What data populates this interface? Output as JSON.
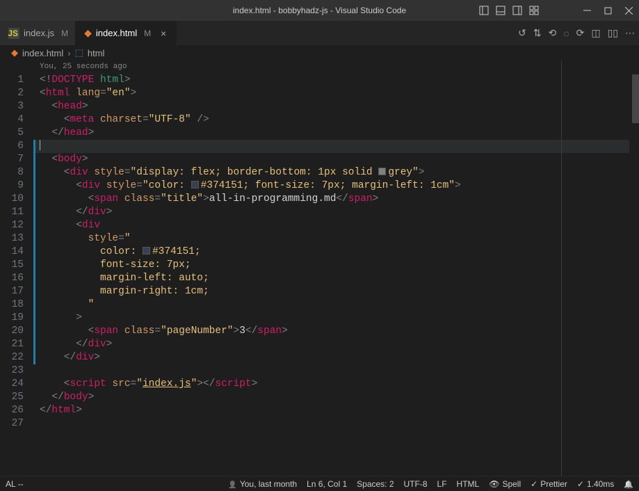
{
  "titleBar": {
    "title": "index.html - bobbyhadz-js - Visual Studio Code"
  },
  "tabs": {
    "items": [
      {
        "label": "index.js",
        "modified": "M"
      },
      {
        "label": "index.html",
        "modified": "M"
      }
    ]
  },
  "breadcrumb": {
    "file": "index.html",
    "symbol": "html"
  },
  "codelens": {
    "text": "You, 25 seconds ago"
  },
  "status": {
    "left": {
      "mode": "AL --"
    },
    "right": {
      "blame": "You, last month",
      "cursor": "Ln 6, Col 1",
      "spaces": "Spaces: 2",
      "encoding": "UTF-8",
      "eol": "LF",
      "lang": "HTML",
      "spell": "Spell",
      "prettier": "Prettier",
      "time": "1.40ms"
    }
  },
  "code": {
    "lines": [
      "1",
      "2",
      "3",
      "4",
      "5",
      "6",
      "7",
      "8",
      "9",
      "10",
      "11",
      "12",
      "13",
      "14",
      "15",
      "16",
      "17",
      "18",
      "19",
      "20",
      "21",
      "22",
      "23",
      "24",
      "25",
      "26",
      "27"
    ],
    "l1_a": "<!",
    "l1_b": "DOCTYPE",
    "l1_c": " html",
    "l1_d": ">",
    "l2_a": "<",
    "l2_b": "html",
    "l2_c": " lang",
    "l2_d": "=",
    "l2_e": "\"en\"",
    "l2_f": ">",
    "l3_a": "  <",
    "l3_b": "head",
    "l3_c": ">",
    "l4_a": "    <",
    "l4_b": "meta",
    "l4_c": " charset",
    "l4_d": "=",
    "l4_e": "\"UTF-8\"",
    "l4_f": " />",
    "l5_a": "  </",
    "l5_b": "head",
    "l5_c": ">",
    "l6_a": "",
    "l7_a": "  <",
    "l7_b": "body",
    "l7_c": ">",
    "l8_a": "    <",
    "l8_b": "div",
    "l8_c": " style",
    "l8_d": "=",
    "l8_e": "\"display: flex; border-bottom: 1px solid ",
    "l8_f": "grey\"",
    "l8_g": ">",
    "l9_a": "      <",
    "l9_b": "div",
    "l9_c": " style",
    "l9_d": "=",
    "l9_e": "\"color: ",
    "l9_f": "#374151; font-size: 7px; margin-left: 1cm\"",
    "l9_g": ">",
    "l10_a": "        <",
    "l10_b": "span",
    "l10_c": " class",
    "l10_d": "=",
    "l10_e": "\"title\"",
    "l10_f": ">",
    "l10_g": "all-in-programming.md",
    "l10_h": "</",
    "l10_i": "span",
    "l10_j": ">",
    "l11_a": "      </",
    "l11_b": "div",
    "l11_c": ">",
    "l12_a": "      <",
    "l12_b": "div",
    "l13_a": "        style",
    "l13_b": "=",
    "l13_c": "\"",
    "l14_a": "          color: ",
    "l14_b": "#374151;",
    "l15_a": "          font-size: 7px;",
    "l16_a": "          margin-left: auto;",
    "l17_a": "          margin-right: 1cm;",
    "l18_a": "        \"",
    "l19_a": "      >",
    "l20_a": "        <",
    "l20_b": "span",
    "l20_c": " class",
    "l20_d": "=",
    "l20_e": "\"pageNumber\"",
    "l20_f": ">",
    "l20_g": "3",
    "l20_h": "</",
    "l20_i": "span",
    "l20_j": ">",
    "l21_a": "      </",
    "l21_b": "div",
    "l21_c": ">",
    "l22_a": "    </",
    "l22_b": "div",
    "l22_c": ">",
    "l23_a": "",
    "l24_a": "    <",
    "l24_b": "script",
    "l24_c": " src",
    "l24_d": "=",
    "l24_e": "\"",
    "l24_f": "index.js",
    "l24_g": "\"",
    "l24_h": "></",
    "l24_i": "script",
    "l24_j": ">",
    "l25_a": "  </",
    "l25_b": "body",
    "l25_c": ">",
    "l26_a": "</",
    "l26_b": "html",
    "l26_c": ">"
  },
  "colors": {
    "c374151": "#374151",
    "grey": "#808080"
  }
}
